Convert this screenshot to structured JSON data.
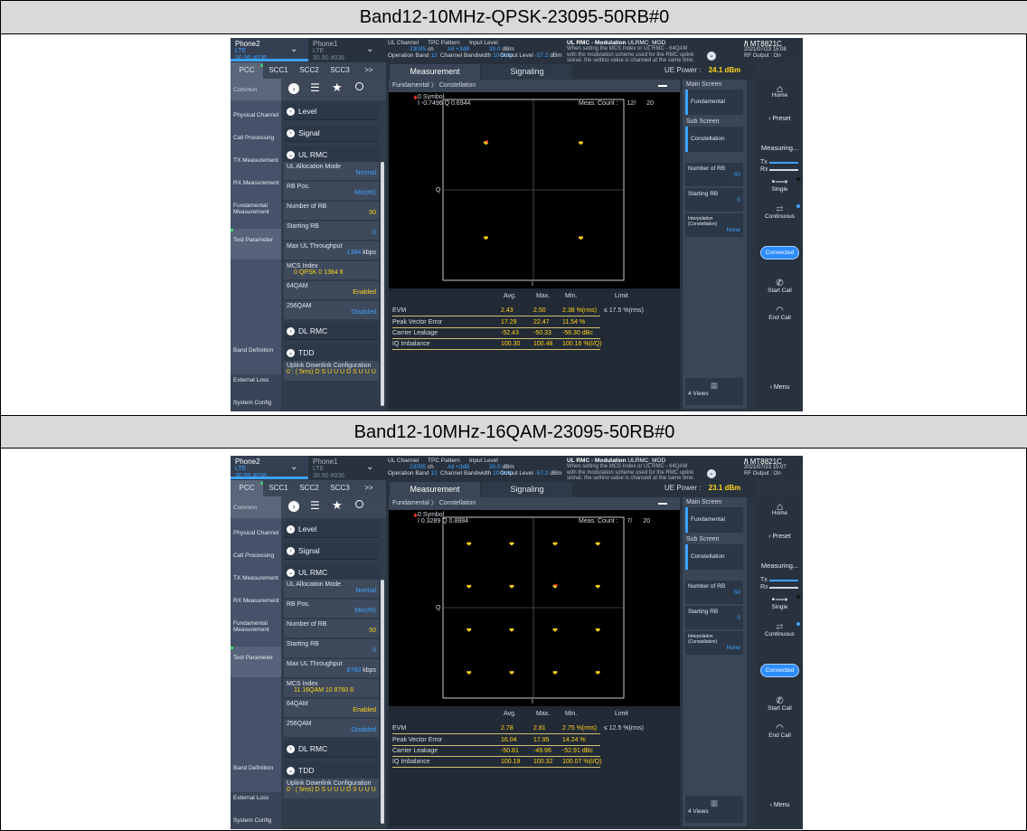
{
  "doc": {
    "headings": [
      "Band12-10MHz-QPSK-23095-50RB#0",
      "Band12-10MHz-16QAM-23095-50RB#0"
    ]
  },
  "common": {
    "phone2": {
      "name": "Phone2",
      "mode": "LTE",
      "detail": "30.90 #036"
    },
    "phone1": {
      "name": "Phone1",
      "mode": "LTE",
      "detail": "30.90 #036"
    },
    "chevron": "⌄",
    "ul_channel_label": "UL Channel",
    "ul_channel_value": "23095",
    "ul_channel_unit": "ch",
    "tpc_label": "TPC Pattern",
    "tpc_value": "All +3dB",
    "input_label": "Input Level",
    "input_value": "30.0",
    "input_unit": "dBm",
    "op_band_label": "Operation Band",
    "op_band_value": "12",
    "ch_bw_label": "Channel Bandwidth",
    "ch_bw_value": "10 MHz",
    "out_label": "Output Level",
    "out_value": "-57.2",
    "out_unit": "dBm",
    "msg_title": "UL RMC - Modulation",
    "msg_id": "ULRMC_MOD",
    "msg_body": "When setting the MCS Index or UL RMC - 64QAM with the modulation scheme used for the RMC uplink signal, the setting value is changed at the same time.",
    "brand": "MT8821C",
    "rf_output": "RF Output : On",
    "tabs": [
      "PCC",
      "SCC1",
      "SCC2",
      "SCC3",
      ">>"
    ],
    "common_label": "Common",
    "nav": [
      "Physical Channel",
      "Call Processing",
      "TX Measurement",
      "RX Measurement",
      "Fundamental Measurement",
      "Test Parameter",
      "Band Definition",
      "External Loss",
      "System Config"
    ],
    "sections": {
      "level": "Level",
      "signal": "Signal",
      "ul_rmc": "UL RMC",
      "dl_rmc": "DL RMC",
      "tdd": "TDD"
    },
    "params": {
      "alloc_label": "UL Allocation Mode",
      "alloc_value": "Normal",
      "rbpos_label": "RB Pos.",
      "rbpos_value": "Min(#0)",
      "numrb_label": "Number of RB",
      "numrb_value": "50",
      "startrb_label": "Starting RB",
      "startrb_value": "0",
      "maxthr_label": "Max UL Throughput",
      "maxthr_unit": "kbps",
      "mcs_label": "MCS Index",
      "qam64_label": "64QAM",
      "qam64_value": "Enabled",
      "qam256_label": "256QAM",
      "qam256_value": "Disabled",
      "uldl_label": "Uplink Downlink Configuration",
      "uldl_value": "0 : ( 5ms) D S U U U D S U U U"
    },
    "meas_tab": "Measurement",
    "sig_tab": "Signaling",
    "ue_power_label": "UE Power :",
    "breadcrumb1": "Fundamental",
    "breadcrumb2": "Constellation",
    "symbol_label": "0 Symbol",
    "meas_count_label": "Meas. Count :",
    "axis_q": "Q",
    "axis_i": "I",
    "tbl_heads": [
      "Avg.",
      "Max.",
      "Min.",
      "Limit"
    ],
    "tbl_rows": [
      "EVM",
      "Peak Vector Error",
      "Carrier Leakage",
      "IQ Imbalance"
    ],
    "units": {
      "evm": "%(rms)",
      "pve": "%",
      "cl": "dBc",
      "iq": "%(I/Q)"
    },
    "main_screen": "Main Screen",
    "fundamental": "Fundamental",
    "sub_screen": "Sub Screen",
    "constellation": "Constellation",
    "rp_numrb": "Number of RB",
    "rp_numrb_value": "50",
    "rp_startrb": "Starting RB",
    "rp_startrb_value": "0",
    "rp_interp": "Interpolation (Constellation)",
    "rp_interp_value": "None",
    "views": "4 Views",
    "home": "Home",
    "preset": "Preset",
    "measuring": "Measuring...",
    "tx": "Tx",
    "rx": "Rx",
    "single": "Single",
    "continuous": "Continuous",
    "connected": "Connected",
    "start_call": "Start Call",
    "end_call": "End Call",
    "menu": "Menu"
  },
  "screens": [
    {
      "date": "2021/07/23 15:08",
      "ue_power": "24.1 dBm",
      "iq_readout": "I -0.7496 Q 0.6944",
      "meas_count": "12/",
      "meas_total": "20",
      "max_thr": "1384",
      "mcs_line": "0  QPSK  0  1384  8",
      "evm": {
        "avg": "2.43",
        "max": "2.50",
        "min": "2.38",
        "limit": "≤ 17.5 %(rms)"
      },
      "pve": {
        "avg": "17.29",
        "max": "22.47",
        "min": "11.54"
      },
      "cl": {
        "avg": "-52.43",
        "max": "-50.33",
        "min": "-56.30"
      },
      "iq": {
        "avg": "100.30",
        "max": "100.48",
        "min": "100.16"
      }
    },
    {
      "date": "2021/07/23 15:07",
      "ue_power": "23.1 dBm",
      "iq_readout": "I 0.3289 Q 0.8884",
      "meas_count": "7/",
      "meas_total": "20",
      "max_thr": "8760",
      "mcs_line": "11  16QAM  10  8760  8",
      "evm": {
        "avg": "2.78",
        "max": "2.81",
        "min": "2.75",
        "limit": "≤ 12.5 %(rms)"
      },
      "pve": {
        "avg": "16.04",
        "max": "17.95",
        "min": "14.24"
      },
      "cl": {
        "avg": "-50.81",
        "max": "-49.96",
        "min": "-52.91"
      },
      "iq": {
        "avg": "100.19",
        "max": "100.32",
        "min": "100.07"
      }
    }
  ],
  "constellations": [
    {
      "name": "QPSK",
      "points": [
        [
          -0.7,
          0.7
        ],
        [
          0.7,
          0.7
        ],
        [
          -0.7,
          -0.7
        ],
        [
          0.7,
          -0.7
        ]
      ]
    },
    {
      "name": "16QAM",
      "points": [
        [
          -0.95,
          0.95
        ],
        [
          -0.32,
          0.95
        ],
        [
          0.32,
          0.95
        ],
        [
          0.95,
          0.95
        ],
        [
          -0.95,
          0.32
        ],
        [
          -0.32,
          0.32
        ],
        [
          0.32,
          0.32
        ],
        [
          0.95,
          0.32
        ],
        [
          -0.95,
          -0.32
        ],
        [
          -0.32,
          -0.32
        ],
        [
          0.32,
          -0.32
        ],
        [
          0.95,
          -0.32
        ],
        [
          -0.95,
          -0.95
        ],
        [
          -0.32,
          -0.95
        ],
        [
          0.32,
          -0.95
        ],
        [
          0.95,
          -0.95
        ]
      ]
    }
  ],
  "colors": {
    "accent": "#3ea2ff",
    "value_yellow": "#ffd21a",
    "point": "#ffd21a",
    "marker": "#ff3b30"
  }
}
